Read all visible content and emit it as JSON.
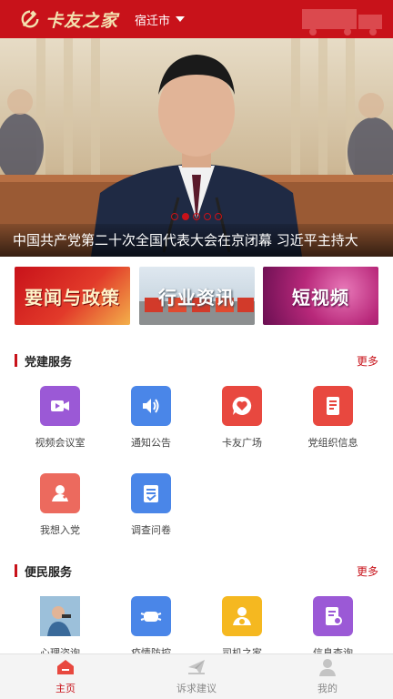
{
  "header": {
    "app_name": "卡友之家",
    "city": "宿迁市"
  },
  "banner": {
    "caption": "中国共产党第二十次全国代表大会在京闭幕 习近平主持大",
    "slide_count": 5,
    "active_slide": 2
  },
  "tiles": [
    {
      "label": "要闻与政策"
    },
    {
      "label": "行业资讯"
    },
    {
      "label": "短视频"
    }
  ],
  "party_section": {
    "title": "党建服务",
    "more": "更多",
    "items": [
      {
        "label": "视频会议室",
        "icon": "video-icon",
        "color": "#9b59d6"
      },
      {
        "label": "通知公告",
        "icon": "speaker-icon",
        "color": "#4a86e8"
      },
      {
        "label": "卡友广场",
        "icon": "heart-chat-icon",
        "color": "#e8483f"
      },
      {
        "label": "党组织信息",
        "icon": "party-doc-icon",
        "color": "#e8483f"
      },
      {
        "label": "我想入党",
        "icon": "join-party-icon",
        "color": "#ec6a5e"
      },
      {
        "label": "调查问卷",
        "icon": "survey-icon",
        "color": "#4a86e8"
      }
    ]
  },
  "service_section": {
    "title": "便民服务",
    "more": "更多",
    "items": [
      {
        "label": "心理咨询",
        "icon": "counseling-photo-icon",
        "color": "#6aa0c8"
      },
      {
        "label": "疫情防控",
        "icon": "mask-icon",
        "color": "#4a86e8"
      },
      {
        "label": "司机之家",
        "icon": "driver-icon",
        "color": "#f5b820"
      },
      {
        "label": "信息查询",
        "icon": "doc-search-icon",
        "color": "#9b59d6"
      }
    ]
  },
  "bottom_nav": [
    {
      "label": "主页",
      "icon": "home-icon",
      "active": true
    },
    {
      "label": "诉求建议",
      "icon": "paper-plane-icon",
      "active": false
    },
    {
      "label": "我的",
      "icon": "user-icon",
      "active": false
    }
  ],
  "colors": {
    "primary": "#c8121a",
    "more_link": "#c8121a"
  }
}
